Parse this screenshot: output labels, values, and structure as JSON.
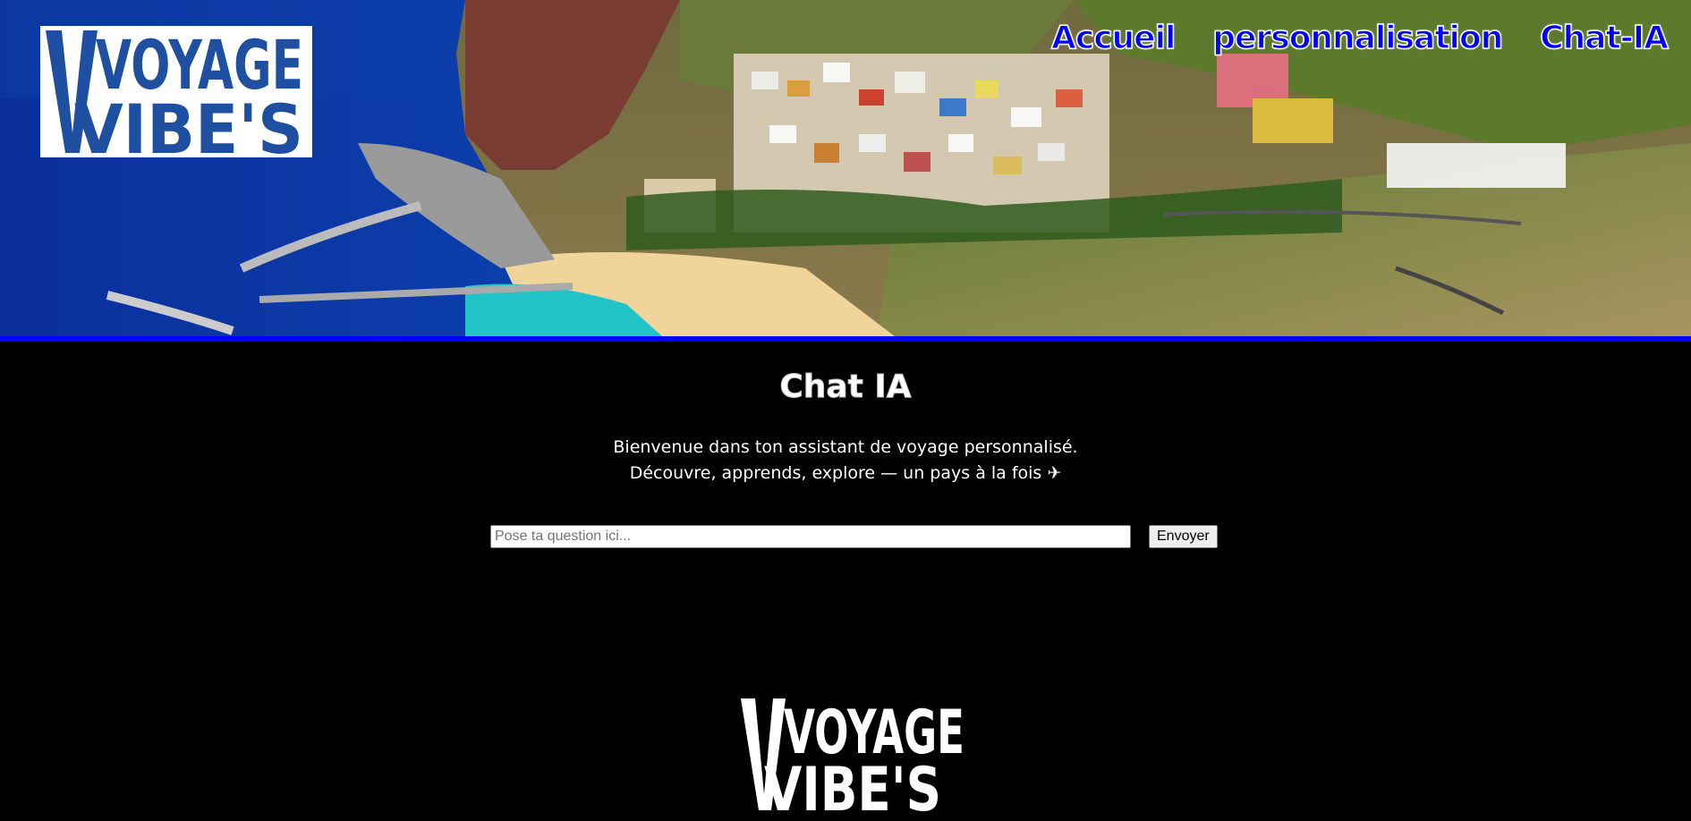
{
  "brand": {
    "logo_line1": "VOYAGE",
    "logo_line2": "VIBE'S",
    "logo_color": "#1f4fa0"
  },
  "nav": {
    "items": [
      {
        "label": "Accueil"
      },
      {
        "label": "personnalisation"
      },
      {
        "label": "Chat-IA"
      }
    ],
    "color": "#0000ff"
  },
  "main": {
    "title": "Chat IA",
    "intro_line1": "Bienvenue dans ton assistant de voyage personnalisé.",
    "intro_line2": "Découvre, apprends, explore — un pays à la fois",
    "intro_icon": "airplane-icon"
  },
  "chat": {
    "placeholder": "Pose ta question ici...",
    "value": "",
    "send_label": "Envoyer"
  },
  "footer": {
    "logo_line1": "VOYAGE",
    "logo_line2": "VIBE'S"
  }
}
